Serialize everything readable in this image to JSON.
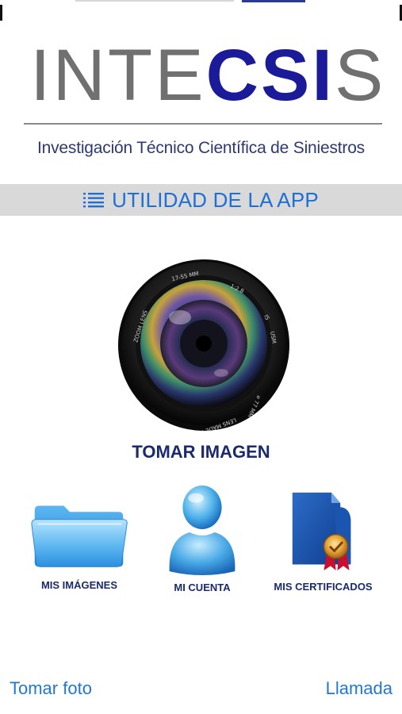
{
  "logo": {
    "brand_part1": "INTE",
    "brand_part2": "CSI",
    "brand_part3": "S",
    "tagline": "Investigación Técnico Científica de Siniestros"
  },
  "utility_bar": {
    "label": "UTILIDAD DE LA APP",
    "icon": "list-icon"
  },
  "camera": {
    "label": "TOMAR IMAGEN",
    "lens_markings": {
      "focal": "17-55 MM",
      "aperture": "1:2.8",
      "is": "IS",
      "usm": "USM",
      "zoom": "ZOOM LENS",
      "filter": "⌀ 77 MM",
      "made": "LENS MADE IN JAPAN"
    }
  },
  "tiles": [
    {
      "label": "MIS IMÁGENES",
      "icon": "folder-icon"
    },
    {
      "label": "MI CUENTA",
      "icon": "user-icon"
    },
    {
      "label": "MIS CERTIFICADOS",
      "icon": "certificate-icon"
    }
  ],
  "bottom": {
    "left_link": "Tomar foto",
    "right_link": "Llamada"
  },
  "colors": {
    "brand_blue": "#1b1b9a",
    "brand_gray": "#707070",
    "link_blue": "#1f78d6",
    "label_navy": "#1b2a6b",
    "bar_gray": "#d9d9d9"
  }
}
